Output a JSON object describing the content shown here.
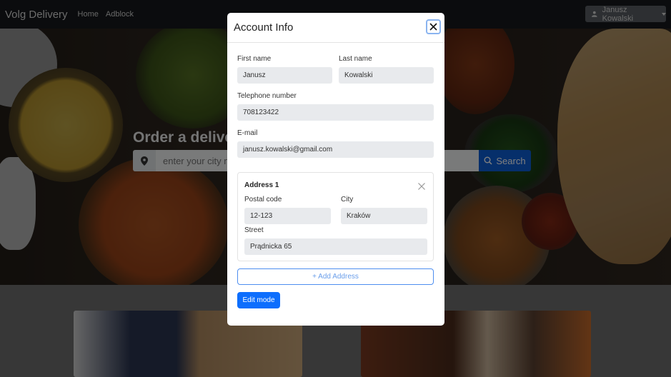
{
  "navbar": {
    "brand": "Volg Delivery",
    "links": [
      "Home",
      "Adblock"
    ],
    "user": "Janusz Kowalski"
  },
  "hero": {
    "title": "Order a delivery",
    "search_placeholder": "enter your city name",
    "search_button": "Search"
  },
  "modal": {
    "title": "Account Info",
    "first_name_label": "First name",
    "first_name": "Janusz",
    "last_name_label": "Last name",
    "last_name": "Kowalski",
    "phone_label": "Telephone number",
    "phone": "708123422",
    "email_label": "E-mail",
    "email": "janusz.kowalski@gmail.com",
    "address": {
      "title": "Address 1",
      "postal_label": "Postal code",
      "postal": "12-123",
      "city_label": "City",
      "city": "Kraków",
      "street_label": "Street",
      "street": "Prądnicka 65"
    },
    "add_address": "+ Add Address",
    "edit_mode": "Edit mode"
  },
  "colors": {
    "primary": "#0d6efd",
    "navbar": "#16191c"
  }
}
